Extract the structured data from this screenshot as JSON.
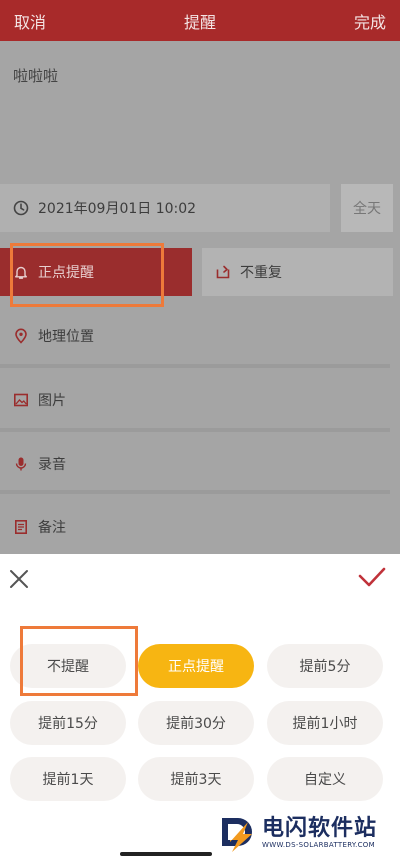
{
  "header": {
    "cancel_label": "取消",
    "title": "提醒",
    "done_label": "完成"
  },
  "note": {
    "content": "啦啦啦"
  },
  "datetime": {
    "value": "2021年09月01日 10:02",
    "allday_label": "全天"
  },
  "alarm": {
    "label": "正点提醒"
  },
  "repeat": {
    "label": "不重复"
  },
  "rows": {
    "location": "地理位置",
    "image": "图片",
    "audio": "录音",
    "remark": "备注"
  },
  "options": [
    {
      "label": "不提醒",
      "selected": false
    },
    {
      "label": "正点提醒",
      "selected": true
    },
    {
      "label": "提前5分",
      "selected": false
    },
    {
      "label": "提前15分",
      "selected": false
    },
    {
      "label": "提前30分",
      "selected": false
    },
    {
      "label": "提前1小时",
      "selected": false
    },
    {
      "label": "提前1天",
      "selected": false
    },
    {
      "label": "提前3天",
      "selected": false
    },
    {
      "label": "自定义",
      "selected": false
    }
  ],
  "watermark": {
    "title": "电闪软件站",
    "url": "WWW.DS-SOLARBATTERY.COM"
  },
  "colors": {
    "header": "#a82a2a",
    "accent": "#f7b512",
    "highlight": "#ee7a3a",
    "check": "#c0323a"
  }
}
